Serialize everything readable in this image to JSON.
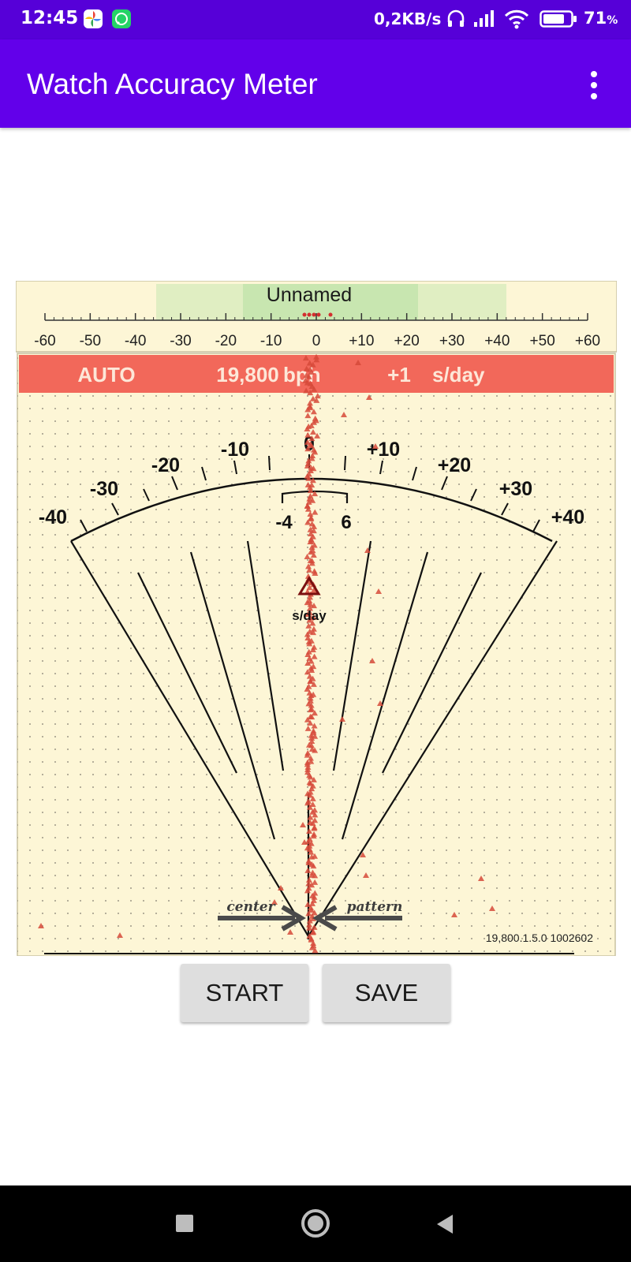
{
  "status_bar": {
    "time": "12:45",
    "app_icons": [
      "photos-icon",
      "whatsapp-icon"
    ],
    "speed": "0,2KB/s",
    "battery_value": "71",
    "battery_unit": "%"
  },
  "app_bar": {
    "title": "Watch Accuracy Meter",
    "menu_icon": "overflow-menu-icon"
  },
  "colors": {
    "status_bar": "#5600d8",
    "app_bar": "#6200ea",
    "panel_bg": "#fdf6d6",
    "info_bar": "#f2685a",
    "marker": "#d64a3a",
    "band_outer": "#e0eec2",
    "band_inner": "#c8e6b0"
  },
  "trace": {
    "name": "Unnamed",
    "ruler_ticks": [
      "-60",
      "-50",
      "-40",
      "-30",
      "-20",
      "-10",
      "0",
      "+10",
      "+20",
      "+30",
      "+40",
      "+50",
      "+60"
    ]
  },
  "info_bar": {
    "mode": "AUTO",
    "beat_rate": "19,800",
    "beat_unit": "bph",
    "rate": "+1",
    "rate_unit": "s/day"
  },
  "meter": {
    "scale_labels": [
      "-40",
      "-30",
      "-20",
      "-10",
      "0",
      "+10",
      "+20",
      "+30",
      "+40"
    ],
    "tolerance_low": "-4",
    "tolerance_high": "6",
    "unit_label": "s/day",
    "center_label": "center",
    "pattern_label": "pattern",
    "version": "19,800.1.5.0 1002602"
  },
  "buttons": {
    "start": "START",
    "save": "SAVE"
  },
  "nav": {
    "recents": "recents-icon",
    "home": "home-icon",
    "back": "back-icon"
  }
}
